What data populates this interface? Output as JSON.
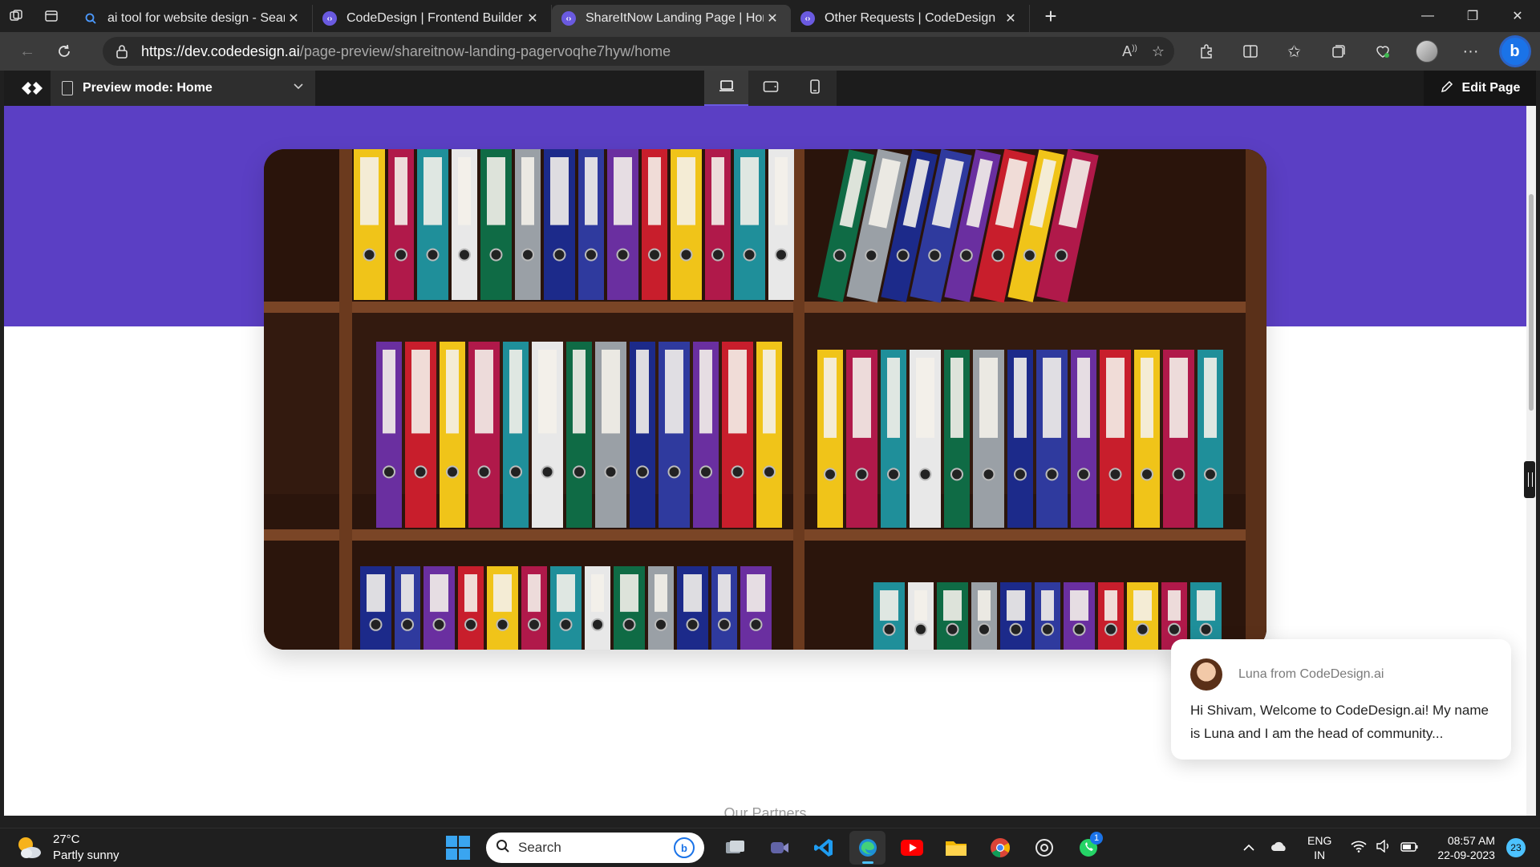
{
  "browser": {
    "tabs": [
      {
        "title": "ai tool for website design - Search",
        "icon": "search-icon",
        "active": false
      },
      {
        "title": "CodeDesign | Frontend Builder",
        "icon": "codedesign-icon",
        "active": false
      },
      {
        "title": "ShareItNow Landing Page | Home",
        "icon": "codedesign-icon",
        "active": true
      },
      {
        "title": "Other Requests | CodeDesign",
        "icon": "codedesign-icon",
        "active": false
      }
    ],
    "address": {
      "host": "https://dev.codedesign.ai",
      "path": "/page-preview/shareitnow-landing-pagervoqhe7hyw/home"
    }
  },
  "codedesign_toolbar": {
    "preview_label": "Preview mode: Home",
    "devices": [
      "desktop-icon",
      "tablet-icon",
      "mobile-icon"
    ],
    "active_device": "desktop-icon",
    "edit_label": "Edit Page"
  },
  "page": {
    "hero_color": "#5b3fc4",
    "hero_image": "shelves of colorful ring binders",
    "partners_heading": "Our Partners"
  },
  "chat": {
    "sender": "Luna from CodeDesign.ai",
    "message": "Hi Shivam, Welcome to CodeDesign.ai! My name is Luna and I am the head of community..."
  },
  "taskbar": {
    "weather_temp": "27°C",
    "weather_desc": "Partly sunny",
    "search_placeholder": "Search",
    "whatsapp_badge": "1",
    "lang_line1": "ENG",
    "lang_line2": "IN",
    "time": "08:57 AM",
    "date": "22-09-2023",
    "notifications": "23"
  }
}
